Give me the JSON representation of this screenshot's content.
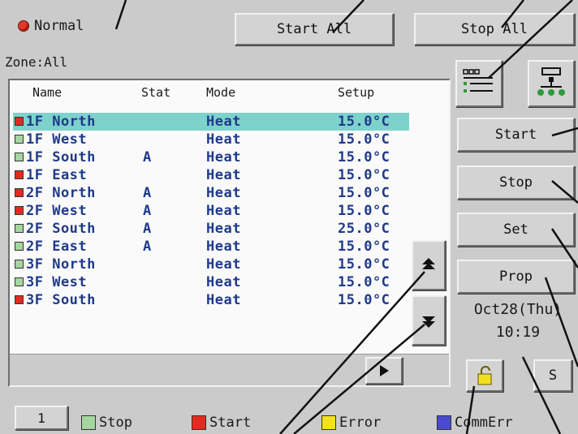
{
  "status": {
    "label": "Normal",
    "color": "#e2382c"
  },
  "toolbar": {
    "start_all": "Start All",
    "stop_all": "Stop All"
  },
  "zone": "Zone:All",
  "columns": {
    "name": "Name",
    "stat": "Stat",
    "mode": "Mode",
    "setup": "Setup"
  },
  "rows": [
    {
      "name": "1F North",
      "stat": "",
      "mode": "Heat",
      "setup": "15.0°C",
      "state": "start",
      "selected": true
    },
    {
      "name": "1F West",
      "stat": "",
      "mode": "Heat",
      "setup": "15.0°C",
      "state": "stop"
    },
    {
      "name": "1F South",
      "stat": "A",
      "mode": "Heat",
      "setup": "15.0°C",
      "state": "stop"
    },
    {
      "name": "1F East",
      "stat": "",
      "mode": "Heat",
      "setup": "15.0°C",
      "state": "start"
    },
    {
      "name": "2F North",
      "stat": "A",
      "mode": "Heat",
      "setup": "15.0°C",
      "state": "start"
    },
    {
      "name": "2F West",
      "stat": "A",
      "mode": "Heat",
      "setup": "15.0°C",
      "state": "start"
    },
    {
      "name": "2F South",
      "stat": "A",
      "mode": "Heat",
      "setup": "25.0°C",
      "state": "stop"
    },
    {
      "name": "2F East",
      "stat": "A",
      "mode": "Heat",
      "setup": "15.0°C",
      "state": "stop"
    },
    {
      "name": "3F North",
      "stat": "",
      "mode": "Heat",
      "setup": "15.0°C",
      "state": "stop"
    },
    {
      "name": "3F West",
      "stat": "",
      "mode": "Heat",
      "setup": "15.0°C",
      "state": "stop"
    },
    {
      "name": "3F South",
      "stat": "",
      "mode": "Heat",
      "setup": "15.0°C",
      "state": "start"
    }
  ],
  "state_colors": {
    "stop": "#a6d6a0",
    "start": "#e02b20",
    "error": "#f2e21a",
    "commerr": "#4a4ad0"
  },
  "actions": {
    "start": "Start",
    "stop": "Stop",
    "set": "Set",
    "prop": "Prop"
  },
  "clock": {
    "date": "Oct28(Thu)",
    "time": "10:19"
  },
  "page_button": "1",
  "s_button": "S",
  "legend": {
    "stop": "Stop",
    "start": "Start",
    "error": "Error",
    "commerr": "CommErr"
  },
  "icons": {
    "group_view": "list-view-icon",
    "tree_view": "tree-view-icon",
    "scroll_up": "page-up-icon",
    "scroll_down": "page-down-icon",
    "scroll_right": "arrow-right-icon",
    "lock": "lock-icon"
  }
}
